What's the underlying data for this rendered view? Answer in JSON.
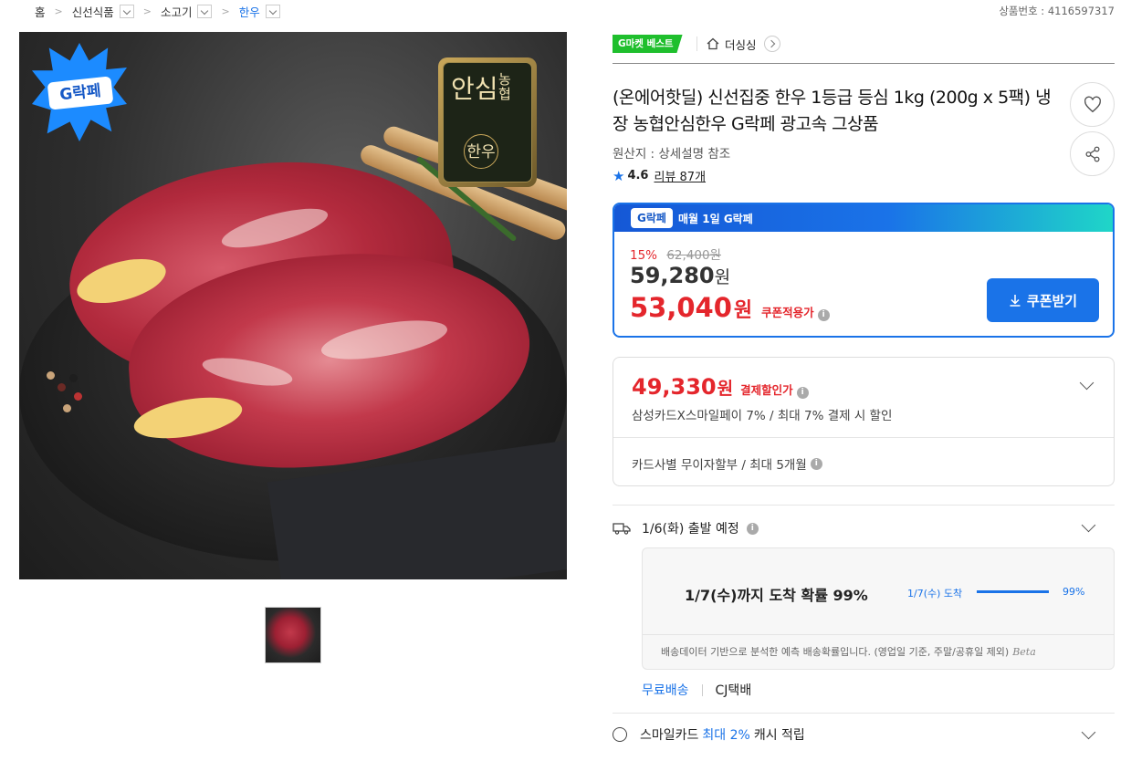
{
  "breadcrumb": [
    {
      "label": "홈"
    },
    {
      "label": "신선식품"
    },
    {
      "label": "소고기"
    },
    {
      "label": "한우"
    }
  ],
  "product_number": "상품번호 : 4116597317",
  "image_badge": "G락페",
  "image_label": {
    "line1": "농협",
    "line2": "안심",
    "line3": "한우"
  },
  "badge_best": "G마켓 베스트",
  "store_name": "더싱싱",
  "title": "(온에어핫딜) 신선집중 한우 1등급 등심 1kg (200g x 5팩) 냉장 농협안심한우 G락페 광고속 그상품",
  "origin": "원산지 : 상세설명 참조",
  "rating": {
    "score": "4.6",
    "reviews": "리뷰 87개"
  },
  "coupon": {
    "header_badge": "G락페",
    "header_text": "매월 1일 G락페",
    "discount_pct": "15%",
    "original_price": "62,400원",
    "price_num": "59,280",
    "price_unit": "원",
    "coupon_price_num": "53,040",
    "coupon_price_unit": "원",
    "coupon_label": "쿠폰적용가",
    "button": "쿠폰받기"
  },
  "payment": {
    "price_num": "49,330",
    "price_unit": "원",
    "label": "결제할인가",
    "desc": "삼성카드X스마일페이 7% / 최대 7% 결제 시 할인",
    "installment": "카드사별 무이자할부 / 최대 5개월"
  },
  "shipping": {
    "departure": "1/6(화) 출발 예정",
    "arrival": "1/7(수)까지 도착 확률 99%",
    "bar_label": "1/7(수) 도착",
    "bar_pct": "99%",
    "bar_value": 0.99,
    "note": "배송데이터 기반으로 분석한 예측 배송확률입니다. (영업일 기준, 주말/공휴일 제외)",
    "beta": "Beta",
    "free": "무료배송",
    "courier": "CJ택배"
  },
  "smilecard": {
    "prefix": "스마일카드",
    "highlight": "최대 2%",
    "suffix": "캐시 적립"
  },
  "colors": {
    "accent": "#1a73e8",
    "sale": "#e4262c",
    "best": "#1fbf2d"
  }
}
